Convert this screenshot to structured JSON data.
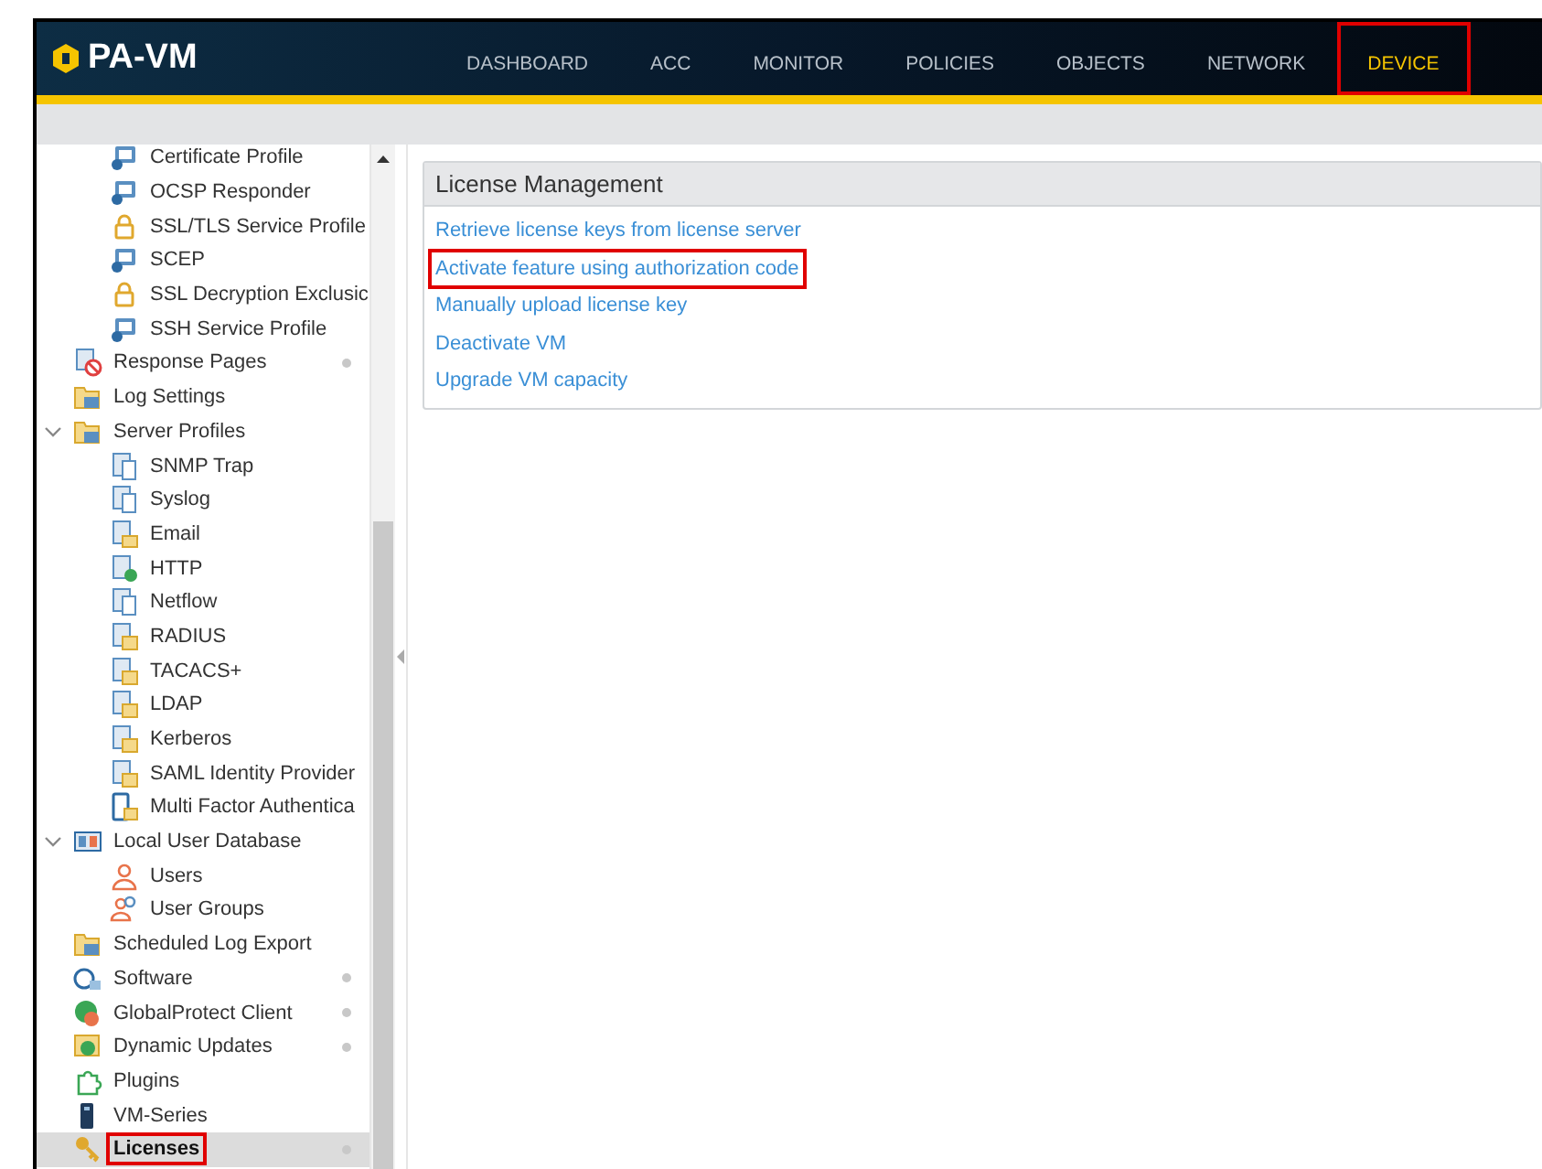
{
  "app": {
    "title": "PA-VM"
  },
  "tabs": [
    {
      "label": "DASHBOARD",
      "selected": false,
      "highlighted": false
    },
    {
      "label": "ACC",
      "selected": false,
      "highlighted": false
    },
    {
      "label": "MONITOR",
      "selected": false,
      "highlighted": false
    },
    {
      "label": "POLICIES",
      "selected": false,
      "highlighted": false
    },
    {
      "label": "OBJECTS",
      "selected": false,
      "highlighted": false
    },
    {
      "label": "NETWORK",
      "selected": false,
      "highlighted": false
    },
    {
      "label": "DEVICE",
      "selected": true,
      "highlighted": true
    }
  ],
  "sidebar": {
    "items": [
      {
        "children": [
          {
            "label": "Certificate Profile",
            "selected": false,
            "dot": false,
            "highlighted": false
          },
          {
            "label": "OCSP Responder",
            "selected": false,
            "dot": false,
            "highlighted": false
          },
          {
            "label": "SSL/TLS Service Profile",
            "selected": false,
            "dot": false,
            "highlighted": false
          },
          {
            "label": "SCEP",
            "selected": false,
            "dot": false,
            "highlighted": false
          },
          {
            "label": "SSL Decryption Exclusic",
            "selected": false,
            "dot": false,
            "highlighted": false
          },
          {
            "label": "SSH Service Profile",
            "selected": false,
            "dot": false,
            "highlighted": false
          }
        ]
      },
      {
        "label": "Response Pages",
        "selected": false,
        "dot": true,
        "highlighted": false
      },
      {
        "label": "Log Settings",
        "selected": false,
        "dot": false,
        "highlighted": false
      },
      {
        "label": "Server Profiles",
        "selected": false,
        "dot": false,
        "highlighted": false,
        "expanded": true,
        "children": [
          {
            "label": "SNMP Trap",
            "selected": false,
            "dot": false,
            "highlighted": false
          },
          {
            "label": "Syslog",
            "selected": false,
            "dot": false,
            "highlighted": false
          },
          {
            "label": "Email",
            "selected": false,
            "dot": false,
            "highlighted": false
          },
          {
            "label": "HTTP",
            "selected": false,
            "dot": false,
            "highlighted": false
          },
          {
            "label": "Netflow",
            "selected": false,
            "dot": false,
            "highlighted": false
          },
          {
            "label": "RADIUS",
            "selected": false,
            "dot": false,
            "highlighted": false
          },
          {
            "label": "TACACS+",
            "selected": false,
            "dot": false,
            "highlighted": false
          },
          {
            "label": "LDAP",
            "selected": false,
            "dot": false,
            "highlighted": false
          },
          {
            "label": "Kerberos",
            "selected": false,
            "dot": false,
            "highlighted": false
          },
          {
            "label": "SAML Identity Provider",
            "selected": false,
            "dot": false,
            "highlighted": false
          },
          {
            "label": "Multi Factor Authentica",
            "selected": false,
            "dot": false,
            "highlighted": false
          }
        ]
      },
      {
        "label": "Local User Database",
        "selected": false,
        "dot": false,
        "highlighted": false,
        "expanded": true,
        "children": [
          {
            "label": "Users",
            "selected": false,
            "dot": false,
            "highlighted": false
          },
          {
            "label": "User Groups",
            "selected": false,
            "dot": false,
            "highlighted": false
          }
        ]
      },
      {
        "label": "Scheduled Log Export",
        "selected": false,
        "dot": false,
        "highlighted": false
      },
      {
        "label": "Software",
        "selected": false,
        "dot": true,
        "highlighted": false
      },
      {
        "label": "GlobalProtect Client",
        "selected": false,
        "dot": true,
        "highlighted": false
      },
      {
        "label": "Dynamic Updates",
        "selected": false,
        "dot": true,
        "highlighted": false
      },
      {
        "label": "Plugins",
        "selected": false,
        "dot": false,
        "highlighted": false
      },
      {
        "label": "VM-Series",
        "selected": false,
        "dot": false,
        "highlighted": false
      },
      {
        "label": "Licenses",
        "selected": true,
        "dot": true,
        "highlighted": true
      }
    ]
  },
  "panel": {
    "title": "License Management",
    "links": [
      {
        "label": "Retrieve license keys from license server",
        "highlighted": false
      },
      {
        "label": "Activate feature using authorization code",
        "highlighted": true
      },
      {
        "label": "Manually upload license key",
        "highlighted": false
      },
      {
        "label": "Deactivate VM",
        "highlighted": false
      },
      {
        "label": "Upgrade VM capacity",
        "highlighted": false
      }
    ]
  }
}
